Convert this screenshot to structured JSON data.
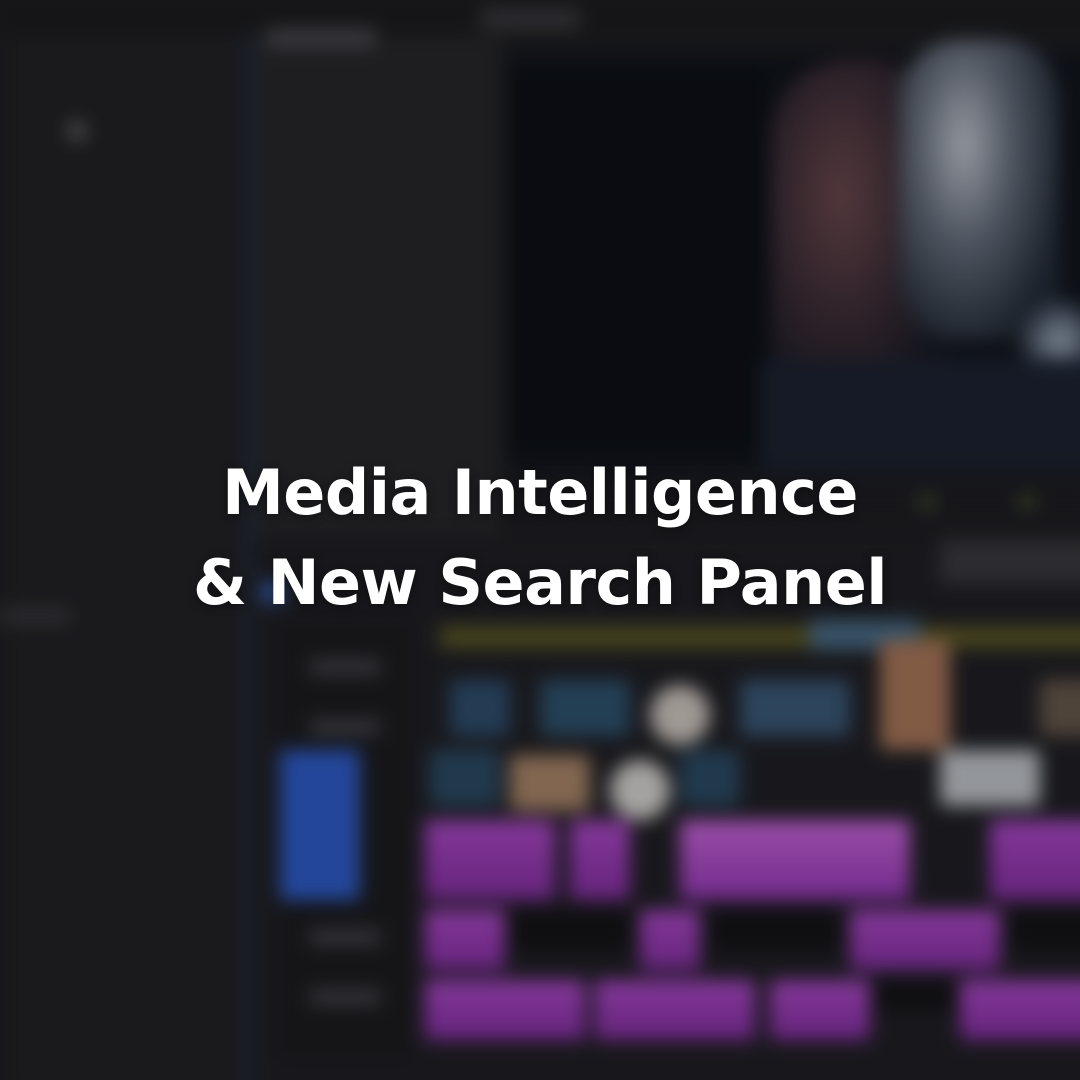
{
  "overlay": {
    "title_line_1": "Media Intelligence",
    "title_line_2": "& New Search Panel"
  },
  "colors": {
    "background": "#1d1d20",
    "audio_clip": "#b44ad0",
    "selected_clip": "#2d5ed0",
    "ruler": "#5e5a22",
    "title_text": "#ffffff"
  }
}
